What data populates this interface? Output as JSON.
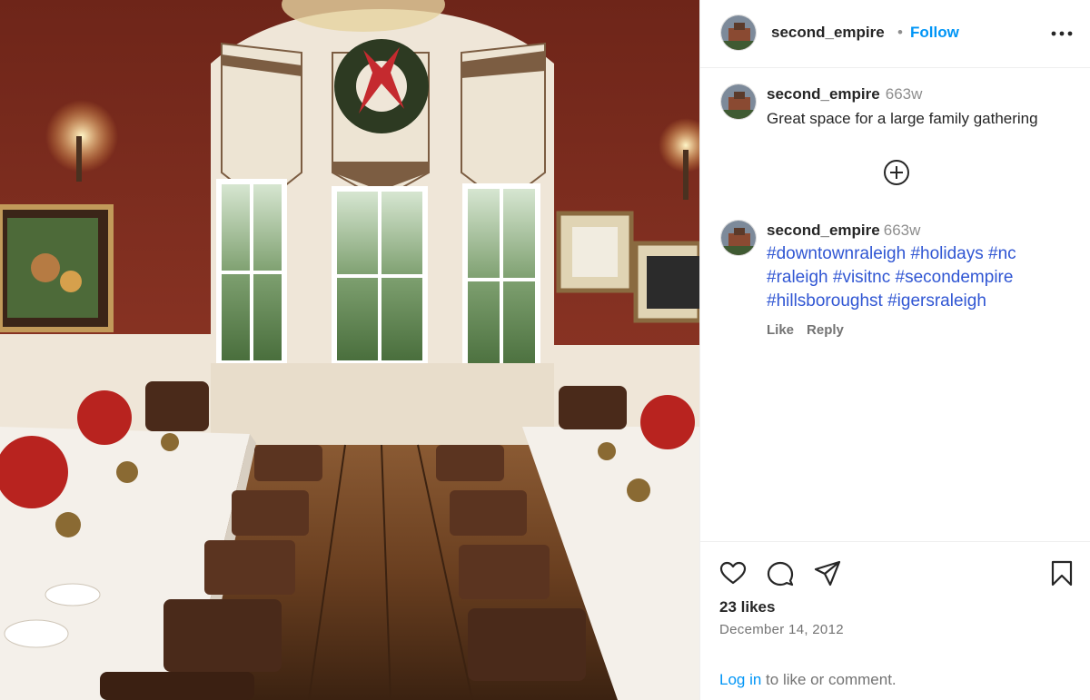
{
  "post": {
    "username": "second_empire",
    "follow_label": "Follow",
    "separator": "•"
  },
  "caption": {
    "username": "second_empire",
    "time": "663w",
    "text": "Great space for a large family gathering"
  },
  "comment": {
    "username": "second_empire",
    "time": "663w",
    "hashtags": [
      "#downtownraleigh",
      "#holidays",
      "#nc",
      "#raleigh",
      "#visitnc",
      "#secondempire",
      "#hillsboroughst",
      "#igersraleigh"
    ],
    "like_label": "Like",
    "reply_label": "Reply"
  },
  "footer": {
    "likes": "23 likes",
    "date": "December 14, 2012",
    "login_link": "Log in",
    "login_suffix": " to like or comment."
  },
  "icons": {
    "more": "more-options-icon",
    "load_more": "plus-circle-icon",
    "like": "heart-icon",
    "comment": "comment-bubble-icon",
    "share": "paper-plane-icon",
    "save": "bookmark-icon"
  },
  "colors": {
    "accent": "#0095f6",
    "hashtag": "#3056d3",
    "muted": "#737373"
  }
}
